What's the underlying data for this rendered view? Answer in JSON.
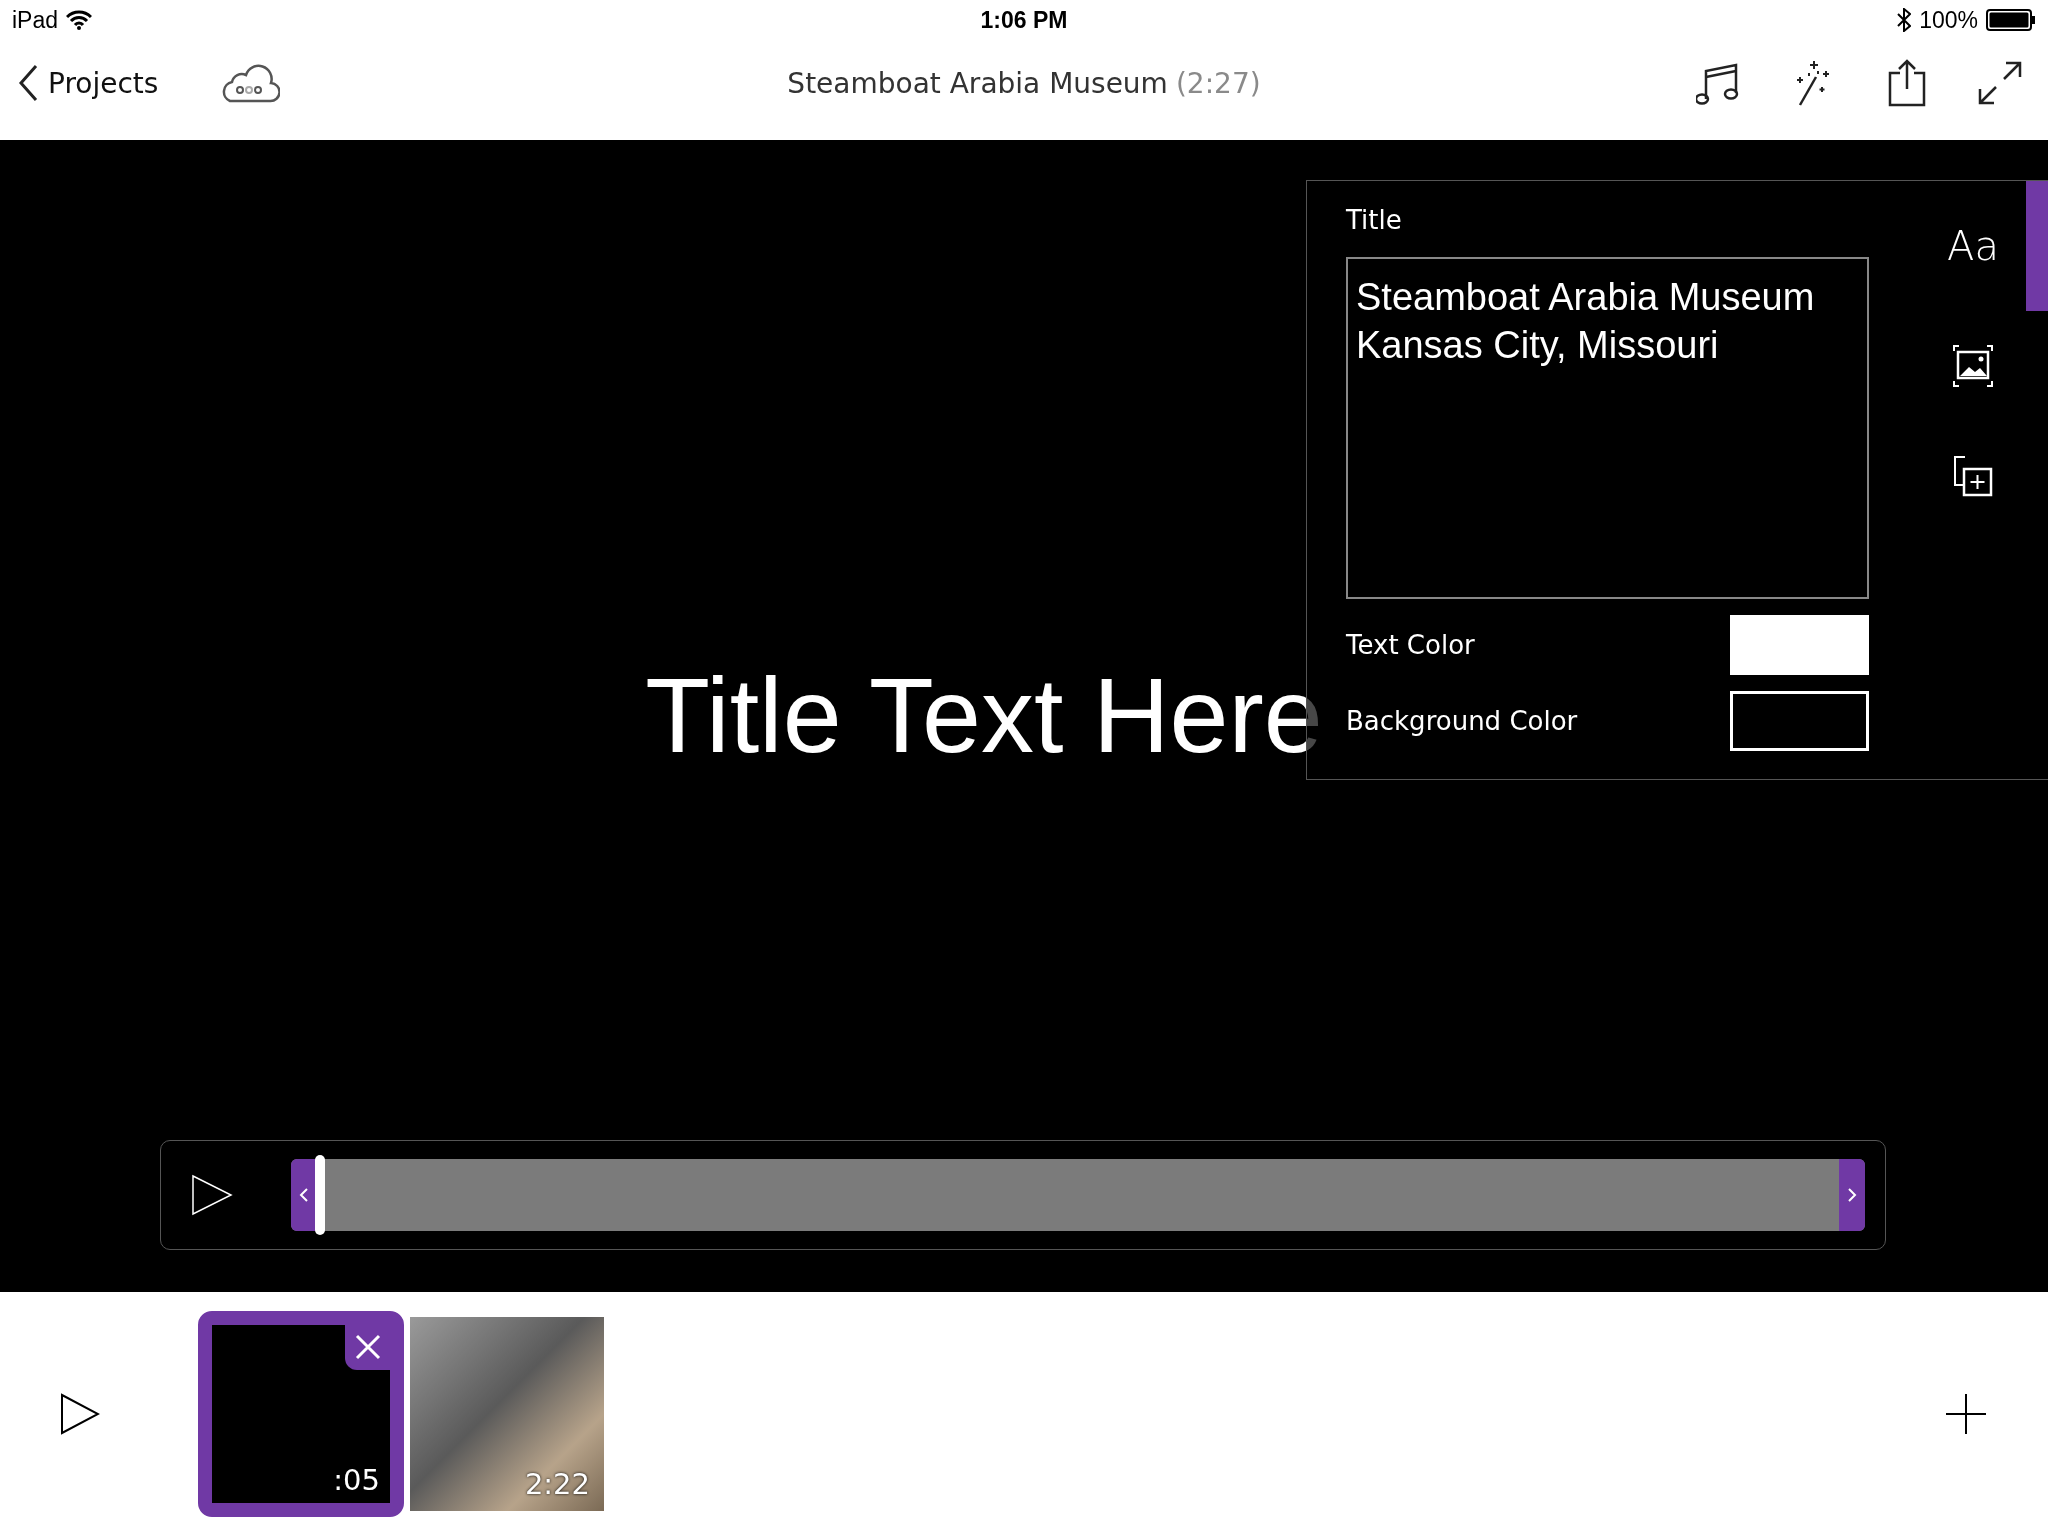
{
  "status_bar": {
    "device": "iPad",
    "time": "1:06 PM",
    "battery": "100%"
  },
  "nav": {
    "back": "Projects",
    "title": "Steamboat Arabia Museum",
    "duration": "(2:27)"
  },
  "preview": {
    "title_text": "Title Text Here"
  },
  "title_panel": {
    "label": "Title",
    "value": "Steamboat Arabia Museum\nKansas City, Missouri",
    "colors": [
      {
        "label": "Text Color",
        "color": "#ffffff"
      },
      {
        "label": "Background Color",
        "color": "#000000"
      }
    ],
    "tabs": [
      {
        "kind": "text",
        "label": "Aa",
        "selected": true
      },
      {
        "kind": "image",
        "selected": false
      },
      {
        "kind": "duplicate",
        "selected": false
      }
    ]
  },
  "scrubber": {
    "playhead": {
      "level": 0
    }
  },
  "clips": [
    {
      "kind": "title",
      "duration": ":05",
      "selected": true
    },
    {
      "kind": "video",
      "duration": "2:22",
      "selected": false
    }
  ]
}
